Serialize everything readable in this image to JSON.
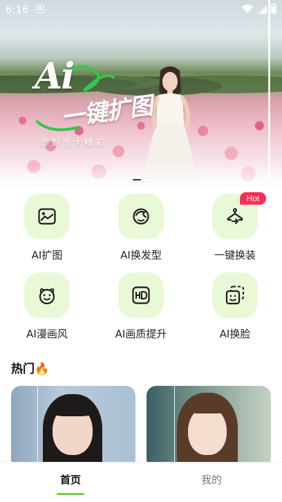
{
  "status_bar": {
    "time": "6:16",
    "notification_icon": "A"
  },
  "banner": {
    "brand_mark": "Ai",
    "title": "一键扩图",
    "subtitle": "即刻放大精彩",
    "carousel": {
      "current": 1,
      "total": 2
    }
  },
  "features": [
    {
      "label": "AI扩图",
      "icon": "expand-image-icon"
    },
    {
      "label": "AI换发型",
      "icon": "hairstyle-icon"
    },
    {
      "label": "一键换装",
      "icon": "outfit-icon",
      "badge": "Hot"
    },
    {
      "label": "AI漫画风",
      "icon": "cartoon-face-icon"
    },
    {
      "label": "AI画质提升",
      "icon": "hd-icon"
    },
    {
      "label": "AI换脸",
      "icon": "face-swap-icon"
    }
  ],
  "hot_section": {
    "title": "热门",
    "title_icon": "🔥"
  },
  "bottom_nav": {
    "items": [
      {
        "label": "首页",
        "active": true
      },
      {
        "label": "我的",
        "active": false
      }
    ]
  },
  "colors": {
    "accent": "#7ac943",
    "tile_bg": "#e9f9d8",
    "hot_badge": "#ff2d55",
    "text": "#222222"
  }
}
